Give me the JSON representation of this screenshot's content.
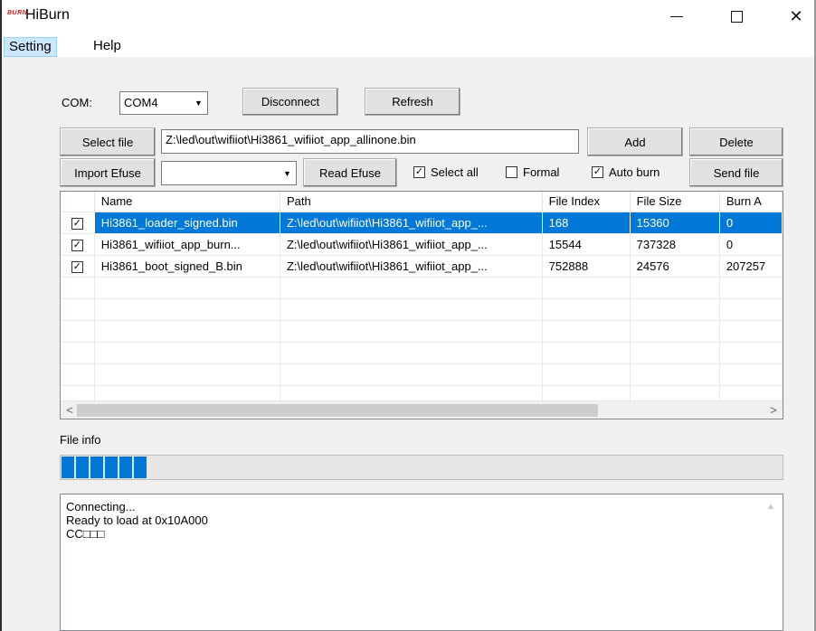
{
  "window": {
    "logo_text": "BURN",
    "title": "HiBurn"
  },
  "menu": {
    "setting": "Setting",
    "help": "Help"
  },
  "com": {
    "label": "COM:",
    "selected": "COM4",
    "disconnect_label": "Disconnect",
    "refresh_label": "Refresh"
  },
  "file": {
    "select_label": "Select file",
    "path_value": "Z:\\led\\out\\wifiiot\\Hi3861_wifiiot_app_allinone.bin",
    "add_label": "Add",
    "delete_label": "Delete"
  },
  "efuse": {
    "import_label": "Import Efuse",
    "combo_value": "",
    "read_label": "Read Efuse",
    "select_all_label": "Select all",
    "select_all_checked": true,
    "formal_label": "Formal",
    "formal_checked": false,
    "auto_burn_label": "Auto burn",
    "auto_burn_checked": true,
    "send_file_label": "Send file"
  },
  "table": {
    "columns": [
      "",
      "Name",
      "Path",
      "File Index",
      "File Size",
      "Burn A"
    ],
    "rows": [
      {
        "checked": true,
        "name": "Hi3861_loader_signed.bin",
        "path": "Z:\\led\\out\\wifiiot\\Hi3861_wifiiot_app_...",
        "file_index": "168",
        "file_size": "15360",
        "burn_addr": "0",
        "selected": true
      },
      {
        "checked": true,
        "name": "Hi3861_wifiiot_app_burn...",
        "path": "Z:\\led\\out\\wifiiot\\Hi3861_wifiiot_app_...",
        "file_index": "15544",
        "file_size": "737328",
        "burn_addr": "0",
        "selected": false
      },
      {
        "checked": true,
        "name": "Hi3861_boot_signed_B.bin",
        "path": "Z:\\led\\out\\wifiiot\\Hi3861_wifiiot_app_...",
        "file_index": "752888",
        "file_size": "24576",
        "burn_addr": "207257",
        "selected": false
      }
    ],
    "empty_rows": 6
  },
  "file_info": {
    "label": "File info",
    "progress_segments": 6
  },
  "log": {
    "lines": [
      "Connecting...",
      "Ready to load at 0x10A000",
      "CC□□□"
    ]
  },
  "colors": {
    "accent": "#0078d7",
    "logo": "#d21f1f"
  }
}
